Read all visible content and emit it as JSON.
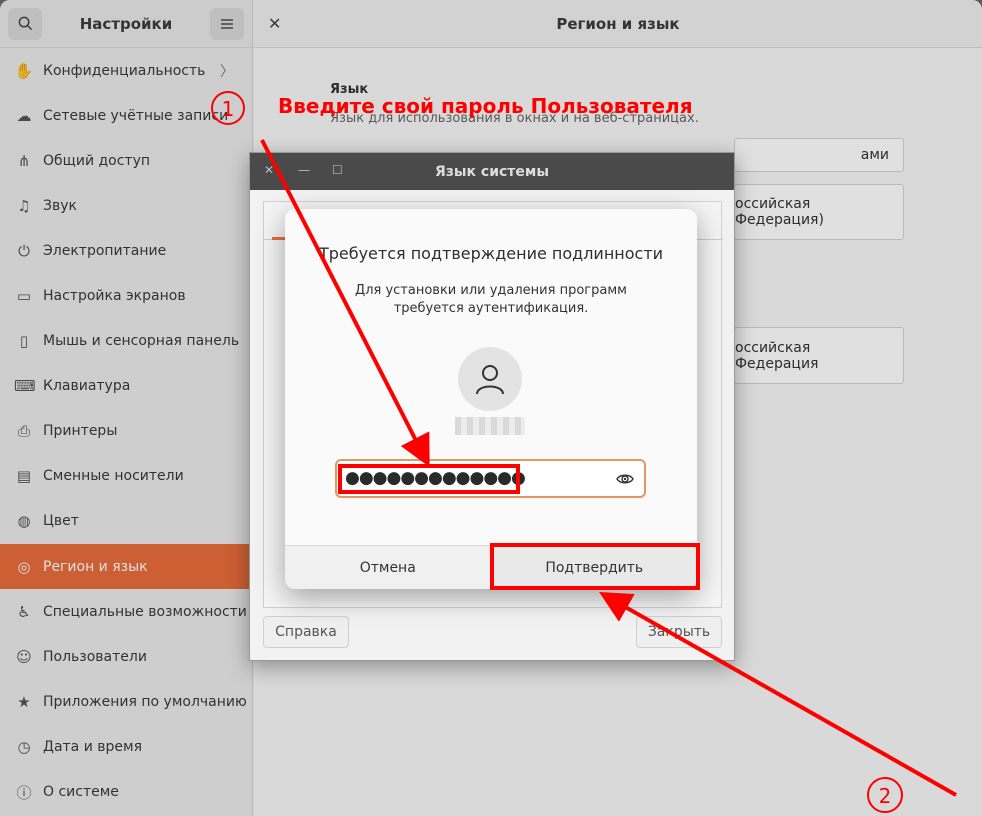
{
  "sidebar": {
    "title": "Настройки",
    "items": [
      {
        "label": "Конфиденциальность",
        "icon": "hand-icon"
      },
      {
        "label": "Сетевые учётные записи",
        "icon": "cloud-icon"
      },
      {
        "label": "Общий доступ",
        "icon": "share-icon"
      },
      {
        "label": "Звук",
        "icon": "music-note-icon"
      },
      {
        "label": "Электропитание",
        "icon": "power-icon"
      },
      {
        "label": "Настройка экранов",
        "icon": "display-icon"
      },
      {
        "label": "Мышь и сенсорная панель",
        "icon": "mouse-icon"
      },
      {
        "label": "Клавиатура",
        "icon": "keyboard-icon"
      },
      {
        "label": "Принтеры",
        "icon": "printer-icon"
      },
      {
        "label": "Сменные носители",
        "icon": "media-icon"
      },
      {
        "label": "Цвет",
        "icon": "color-icon"
      },
      {
        "label": "Регион и язык",
        "icon": "globe-icon"
      },
      {
        "label": "Специальные возможности",
        "icon": "accessibility-icon"
      },
      {
        "label": "Пользователи",
        "icon": "users-icon"
      },
      {
        "label": "Приложения по умолчанию",
        "icon": "star-icon"
      },
      {
        "label": "Дата и время",
        "icon": "clock-icon"
      },
      {
        "label": "О системе",
        "icon": "info-icon"
      }
    ],
    "active_index": 11,
    "accent_color": "#e96d3b"
  },
  "content": {
    "title": "Регион и язык",
    "section_title": "Язык",
    "section_subtitle": "Язык для использования в окнах и на веб-страницах.",
    "row_manage": "ами",
    "row_format1": "оссийская Федерация)",
    "row_format2": "оссийская Федерация"
  },
  "lang_dialog": {
    "title": "Язык системы",
    "help_button": "Справка",
    "close_button": "Закрыть"
  },
  "auth_dialog": {
    "heading": "Требуется подтверждение подлинности",
    "desc_line1": "Для установки или удаления программ",
    "desc_line2": "требуется аутентификация.",
    "password_mask": "●●●●●●●●●●●●●",
    "cancel_label": "Отмена",
    "confirm_label": "Подтвердить"
  },
  "annotations": {
    "step1_number": "1",
    "step1_text": "Введите свой пароль Пользователя",
    "step2_number": "2",
    "color": "#ff0000"
  }
}
